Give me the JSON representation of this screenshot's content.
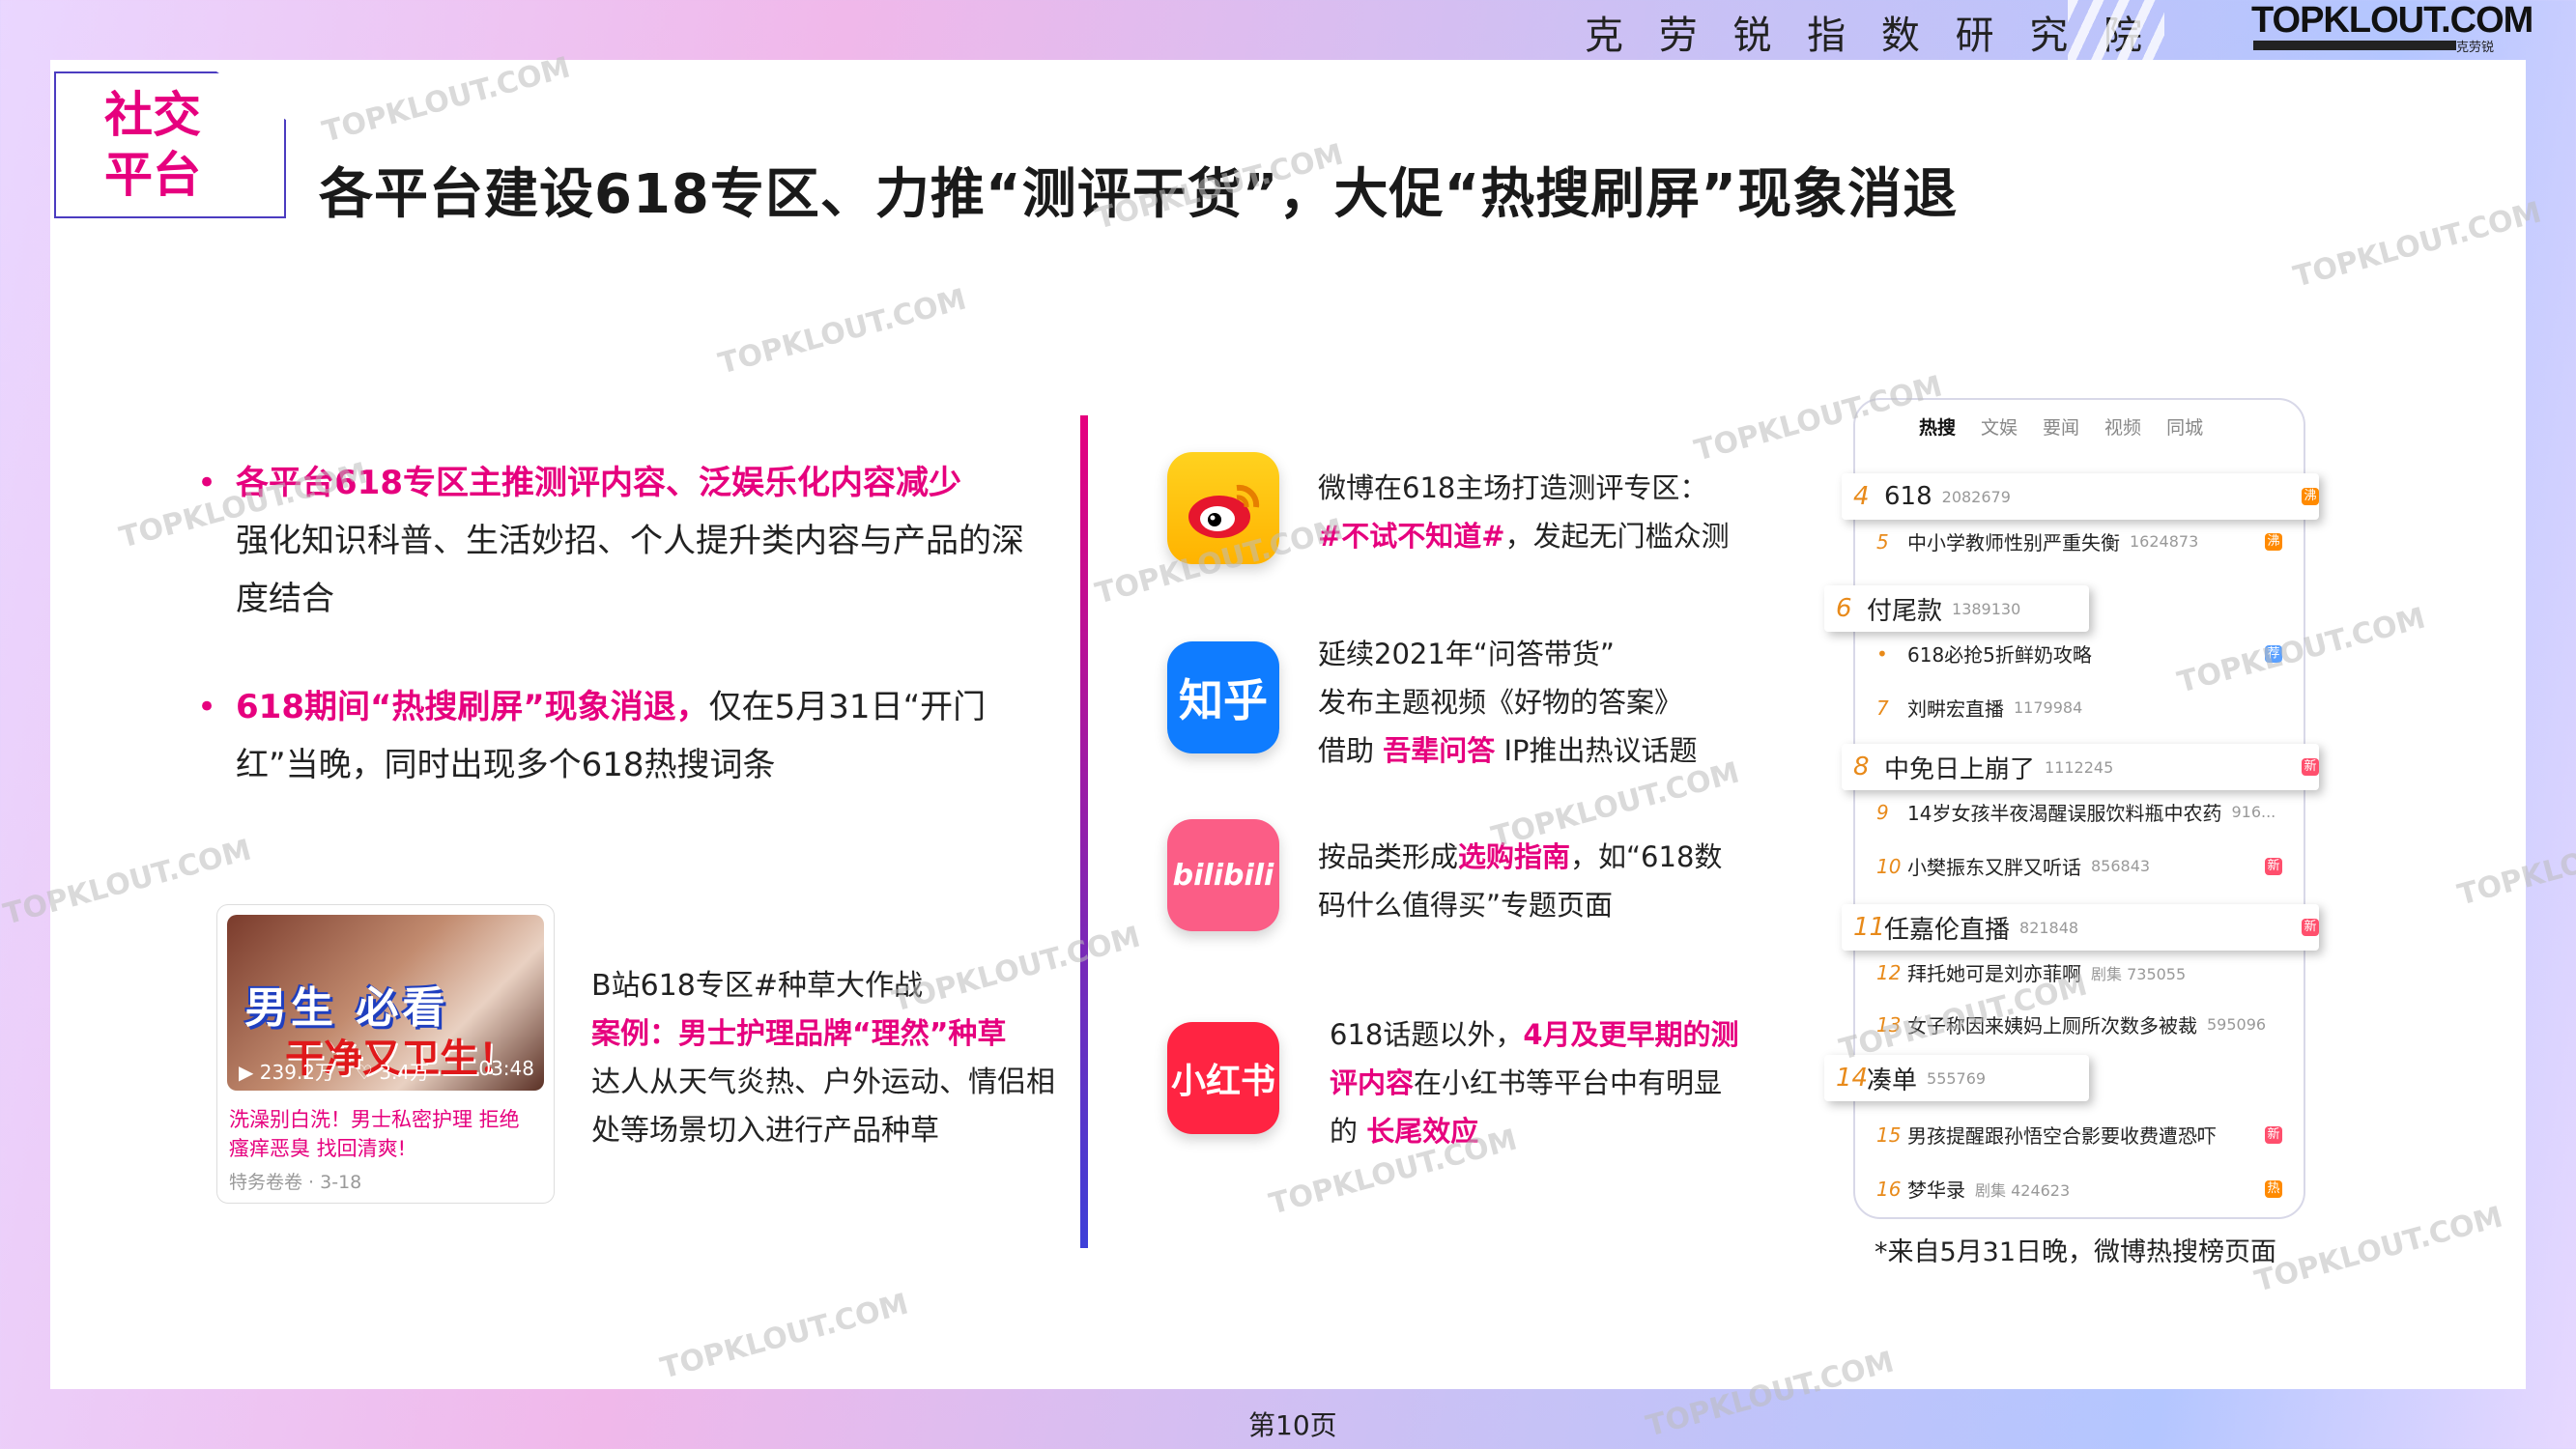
{
  "header": {
    "institute": "克 劳 锐 指 数 研 究 院",
    "logo": "TOPKLOUT.COM",
    "logo_sub": "克劳锐"
  },
  "tag": {
    "line1": "社交",
    "line2": "平台"
  },
  "title": "各平台建设618专区、力推“测评干货”，大促“热搜刷屏”现象消退",
  "bullets": [
    {
      "highlight": "各平台618专区主推测评内容、泛娱乐化内容减少",
      "text": "强化知识科普、生活妙招、个人提升类内容与产品的深度结合"
    },
    {
      "highlight": "618期间“热搜刷屏”现象消退，",
      "text": "仅在5月31日“开门红”当晚，同时出现多个618热搜词条"
    }
  ],
  "video_card": {
    "overlay_big": "男生  必看",
    "overlay_red": "干净又卫生！",
    "views": "239.2万",
    "likes": "3.4万",
    "duration": "03:48",
    "line1": "洗澡别白洗！男士私密护理 拒绝",
    "line2": "瘙痒恶臭 找回清爽!",
    "author": "特务卷卷 · 3-18"
  },
  "case": {
    "line1": "B站618专区#种草大作战",
    "line2": "案例：男士护理品牌“理然”种草",
    "line3": "达人从天气炎热、户外运动、情侣相",
    "line4": "处等场景切入进行产品种草"
  },
  "platforms": {
    "weibo": {
      "l1": "微博在618主场打造测评专区：",
      "l2_hl": "#不试不知道#",
      "l2": "，发起无门槛众测"
    },
    "zhihu": {
      "icon": "知乎",
      "l1": "延续2021年“问答带货”",
      "l2": "发布主题视频《好物的答案》",
      "l3a": "借助 ",
      "l3_hl": "吾辈问答",
      "l3b": " IP推出热议话题"
    },
    "bilibili": {
      "icon": "bilibili",
      "l1a": "按品类形成",
      "l1_hl": "选购指南",
      "l1b": "，如“618数",
      "l2": "码什么值得买”专题页面"
    },
    "xiaohongshu": {
      "icon": "小红书",
      "l1a": "618话题以外，",
      "l1_hl": "4月及更早期的测",
      "l2_hl": "评内容",
      "l2b": "在小红书等平台中有明显",
      "l3a": "的 ",
      "l3_hl": "长尾效应"
    }
  },
  "feed": {
    "tabs": [
      "热搜",
      "文娱",
      "要闻",
      "视频",
      "同城"
    ],
    "rows": [
      {
        "rank": "4",
        "title": "618",
        "count": "2082679",
        "badge": "沸",
        "big": true
      },
      {
        "rank": "5",
        "title": "中小学教师性别严重失衡",
        "count": "1624873",
        "badge": "沸"
      },
      {
        "rank": "6",
        "title": "付尾款",
        "count": "1389130",
        "badge": "",
        "big": true
      },
      {
        "rank": "•",
        "title": "618必抢5折鲜奶攻略",
        "count": "",
        "badge": "荐"
      },
      {
        "rank": "7",
        "title": "刘畊宏直播",
        "count": "1179984",
        "badge": ""
      },
      {
        "rank": "8",
        "title": "中免日上崩了",
        "count": "1112245",
        "badge": "新",
        "big": true
      },
      {
        "rank": "9",
        "title": "14岁女孩半夜渴醒误服饮料瓶中农药",
        "count": "916...",
        "badge": ""
      },
      {
        "rank": "10",
        "title": "小樊振东又胖又听话",
        "count": "856843",
        "badge": "新"
      },
      {
        "rank": "11",
        "title": "任嘉伦直播",
        "count": "821848",
        "badge": "新",
        "big": true
      },
      {
        "rank": "12",
        "title": "拜托她可是刘亦菲啊",
        "count": "剧集 735055",
        "badge": ""
      },
      {
        "rank": "13",
        "title": "女子称因来姨妈上厕所次数多被裁",
        "count": "595096",
        "badge": ""
      },
      {
        "rank": "14",
        "title": "凑单",
        "count": "555769",
        "badge": "",
        "big": true
      },
      {
        "rank": "15",
        "title": "男孩提醒跟孙悟空合影要收费遭恐吓",
        "count": "",
        "badge": "新"
      },
      {
        "rank": "16",
        "title": "梦华录",
        "count": "剧集 424623",
        "badge": "热"
      }
    ],
    "note": "*来自5月31日晚，微博热搜榜页面"
  },
  "footer": {
    "page": "第10页"
  },
  "watermark": "TOPKLOUT.COM",
  "colors": {
    "accent": "#e6007e",
    "divider_top": "#e6007e",
    "divider_bottom": "#3d40d8"
  }
}
